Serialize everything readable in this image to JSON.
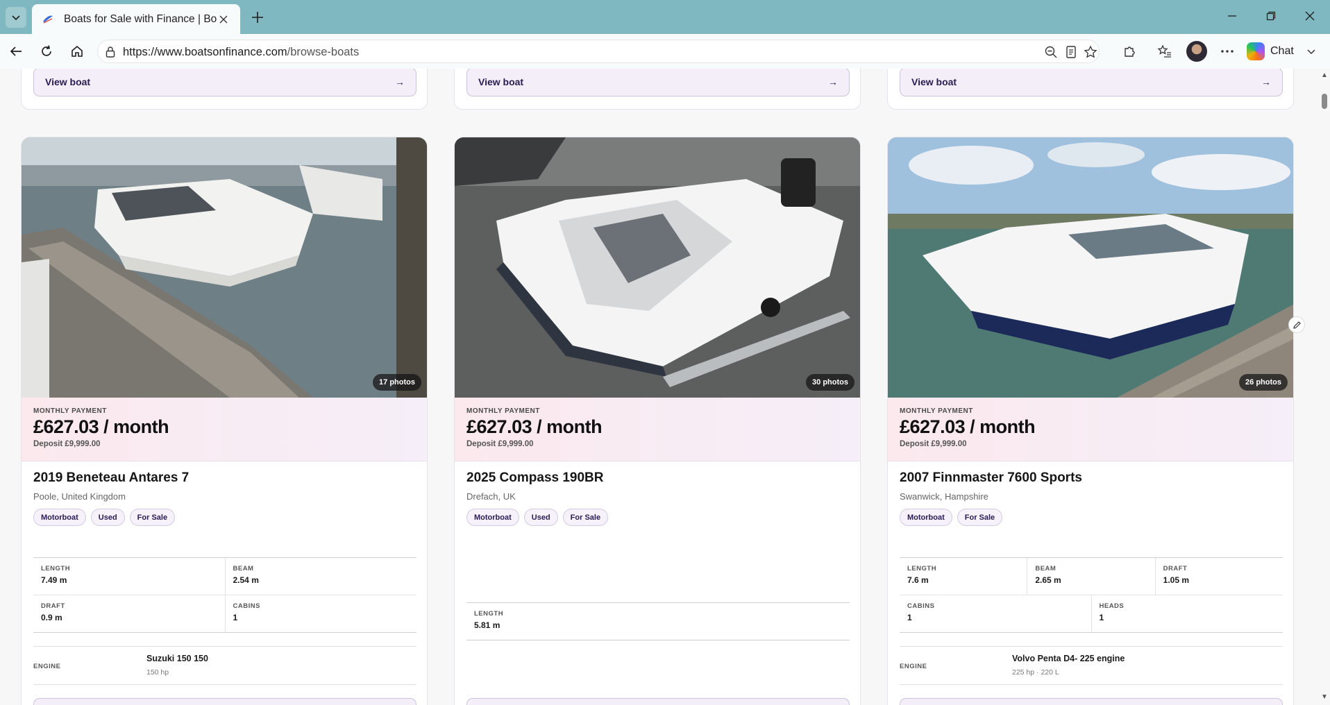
{
  "browser": {
    "tab_title": "Boats for Sale with Finance | Boats",
    "url_host": "https://www.boatsonfinance.com",
    "url_path": "/browse-boats",
    "chat_label": "Chat"
  },
  "previous_row": {
    "view_label": "View boat",
    "arrow": "→"
  },
  "listings": [
    {
      "photo_count": "17 photos",
      "payment_label": "MONTHLY PAYMENT",
      "monthly": "£627.03 / month",
      "deposit": "Deposit £9,999.00",
      "name": "2019 Beneteau Antares 7",
      "location": "Poole, United Kingdom",
      "tags": [
        "Motorboat",
        "Used",
        "For Sale"
      ],
      "specs": {
        "length_label": "LENGTH",
        "length": "7.49 m",
        "beam_label": "BEAM",
        "beam": "2.54 m",
        "draft_label": "DRAFT",
        "draft": "0.9 m",
        "cabins_label": "CABINS",
        "cabins": "1"
      },
      "engine_label": "ENGINE",
      "engine_name": "Suzuki 150 150",
      "engine_details": "150 hp"
    },
    {
      "photo_count": "30 photos",
      "payment_label": "MONTHLY PAYMENT",
      "monthly": "£627.03 / month",
      "deposit": "Deposit £9,999.00",
      "name": "2025 Compass 190BR",
      "location": "Drefach, UK",
      "tags": [
        "Motorboat",
        "Used",
        "For Sale"
      ],
      "specs": {
        "length_label": "LENGTH",
        "length": "5.81 m"
      }
    },
    {
      "photo_count": "26 photos",
      "payment_label": "MONTHLY PAYMENT",
      "monthly": "£627.03 / month",
      "deposit": "Deposit £9,999.00",
      "name": "2007 Finnmaster 7600 Sports",
      "location": "Swanwick, Hampshire",
      "tags": [
        "Motorboat",
        "For Sale"
      ],
      "specs": {
        "length_label": "LENGTH",
        "length": "7.6 m",
        "beam_label": "BEAM",
        "beam": "2.65 m",
        "draft_label": "DRAFT",
        "draft": "1.05 m",
        "cabins_label": "CABINS",
        "cabins": "1",
        "heads_label": "HEADS",
        "heads": "1"
      },
      "engine_label": "ENGINE",
      "engine_name": "Volvo Penta D4- 225 engine",
      "engine_details": "225 hp · 220 L"
    }
  ],
  "colors": {
    "tabbar": "#7fb8c0",
    "accent": "#2a1b55",
    "payment_bg": "#fbe9ee"
  }
}
